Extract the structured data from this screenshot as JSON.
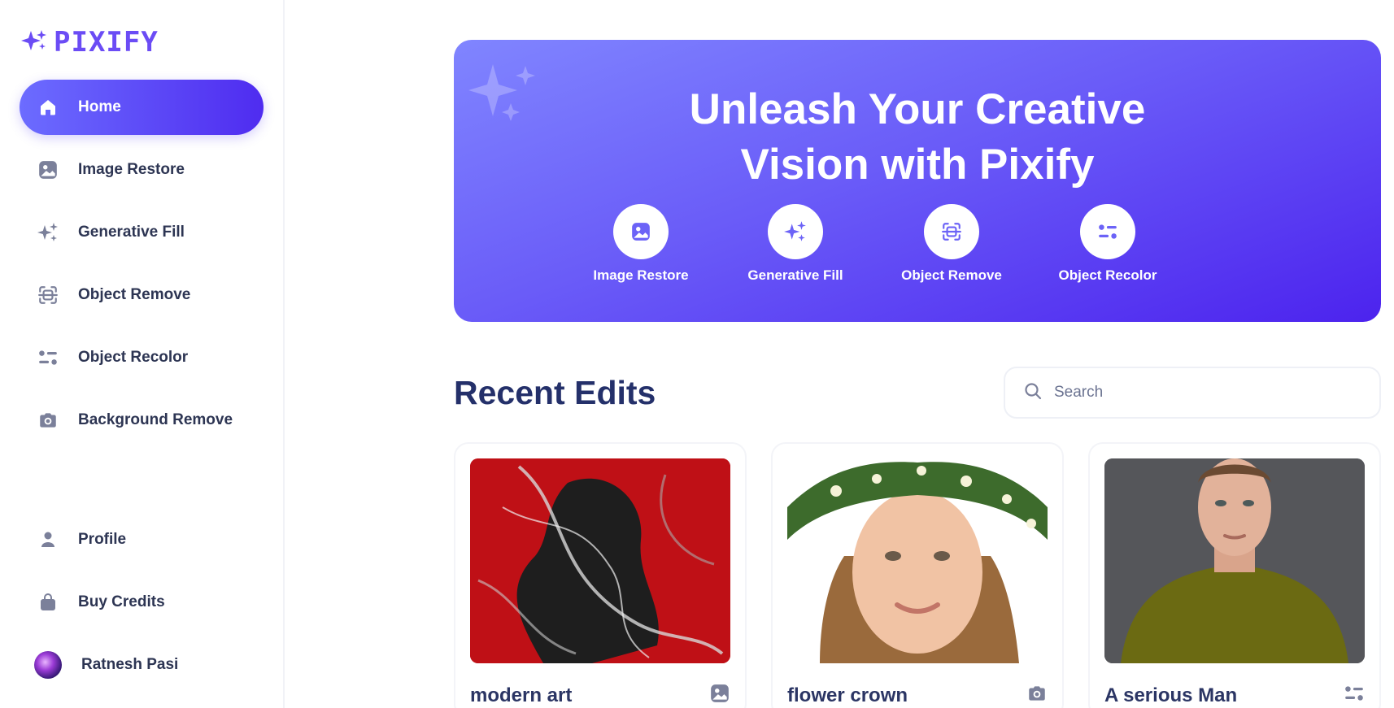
{
  "brand": {
    "name": "PIXIFY",
    "color": "#6b4cf5"
  },
  "sidebar": {
    "items": [
      {
        "label": "Home",
        "icon": "home-icon",
        "active": true
      },
      {
        "label": "Image Restore",
        "icon": "image-icon"
      },
      {
        "label": "Generative Fill",
        "icon": "sparkles-icon"
      },
      {
        "label": "Object Remove",
        "icon": "scan-icon"
      },
      {
        "label": "Object Recolor",
        "icon": "filter-icon"
      },
      {
        "label": "Background Remove",
        "icon": "camera-icon"
      }
    ],
    "bottom": [
      {
        "label": "Profile",
        "icon": "user-icon"
      },
      {
        "label": "Buy Credits",
        "icon": "bag-icon"
      },
      {
        "label": "Ratnesh Pasi",
        "icon": "avatar"
      }
    ]
  },
  "hero": {
    "title_line1": "Unleash Your Creative",
    "title_line2": "Vision with Pixify",
    "actions": [
      {
        "label": "Image Restore",
        "icon": "image-icon"
      },
      {
        "label": "Generative Fill",
        "icon": "sparkles-icon"
      },
      {
        "label": "Object Remove",
        "icon": "scan-icon"
      },
      {
        "label": "Object Recolor",
        "icon": "filter-icon"
      }
    ]
  },
  "recent": {
    "title": "Recent Edits",
    "search_placeholder": "Search",
    "cards": [
      {
        "title": "modern art",
        "icon": "image-icon"
      },
      {
        "title": "flower crown",
        "icon": "camera-icon"
      },
      {
        "title": "A serious Man",
        "icon": "filter-icon"
      }
    ]
  },
  "colors": {
    "accent": "#5b3cf2",
    "text_dark": "#24306a",
    "icon_gray": "#7b809a"
  }
}
